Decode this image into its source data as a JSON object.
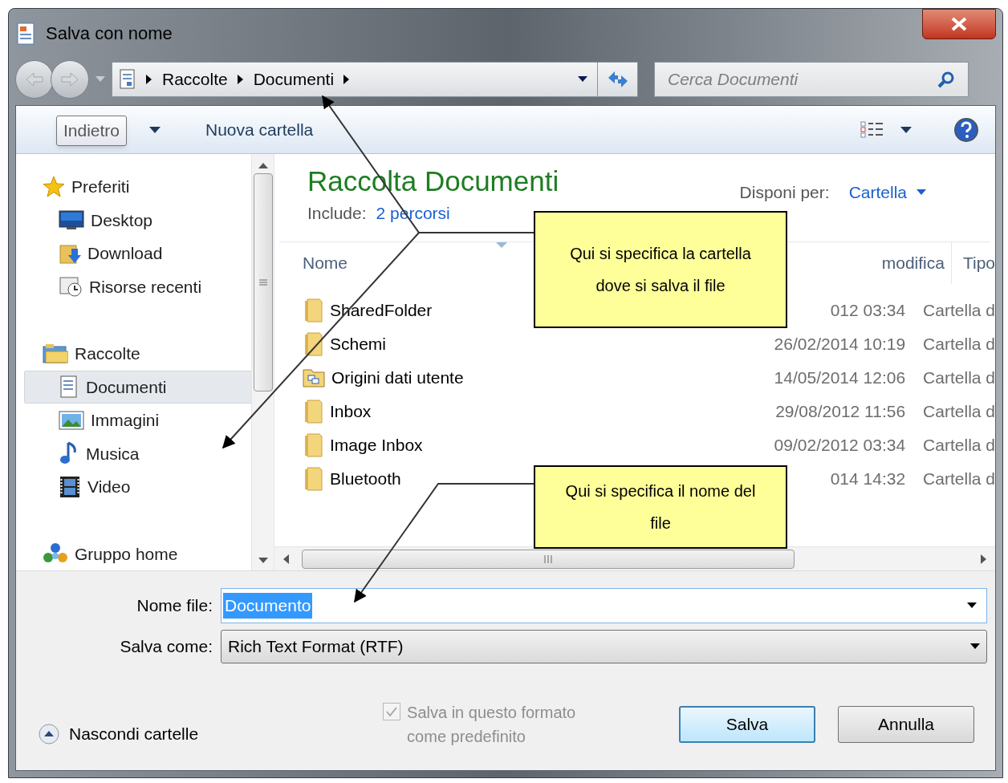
{
  "window": {
    "title": "Salva con nome"
  },
  "address": {
    "crumbs": [
      "Raccolte",
      "Documenti"
    ]
  },
  "search": {
    "placeholder": "Cerca Documenti"
  },
  "tooltip": "Indietro",
  "toolbar": {
    "new_folder": "Nuova cartella"
  },
  "sidebar": {
    "items": [
      {
        "label": "Preferiti",
        "kind": "star",
        "selected": false,
        "children": [
          {
            "label": "Desktop",
            "kind": "desktop",
            "selected": false
          },
          {
            "label": "Download",
            "kind": "download",
            "selected": false
          },
          {
            "label": "Risorse recenti",
            "kind": "recent",
            "selected": false
          }
        ]
      },
      {
        "label": "Raccolte",
        "kind": "library",
        "selected": false,
        "children": [
          {
            "label": "Documenti",
            "kind": "document",
            "selected": true
          },
          {
            "label": "Immagini",
            "kind": "images",
            "selected": false
          },
          {
            "label": "Musica",
            "kind": "music",
            "selected": false
          },
          {
            "label": "Video",
            "kind": "video",
            "selected": false
          }
        ]
      },
      {
        "label": "Gruppo home",
        "kind": "homegroup",
        "selected": false
      }
    ]
  },
  "library": {
    "title": "Raccolta Documenti",
    "include_label": "Include:",
    "include_link": "2 percorsi",
    "arrange_label": "Disponi per:",
    "arrange_value": "Cartella"
  },
  "table": {
    "columns": [
      "Nome",
      "modifica",
      "Tipo"
    ],
    "rows": [
      {
        "name": "SharedFolder",
        "kind": "folder",
        "date": "012 03:34",
        "type": "Cartella d"
      },
      {
        "name": "Schemi",
        "kind": "folder",
        "date": "26/02/2014 10:19",
        "type": "Cartella d"
      },
      {
        "name": "Origini dati utente",
        "kind": "datasource",
        "date": "14/05/2014 12:06",
        "type": "Cartella d"
      },
      {
        "name": "Inbox",
        "kind": "folder",
        "date": "29/08/2012 11:56",
        "type": "Cartella d"
      },
      {
        "name": "Image Inbox",
        "kind": "folder",
        "date": "09/02/2012 03:34",
        "type": "Cartella d"
      },
      {
        "name": "Bluetooth",
        "kind": "folder",
        "date": "014 14:32",
        "type": "Cartella d"
      }
    ]
  },
  "form": {
    "filename_label": "Nome file:",
    "filename": "Documento",
    "format_label": "Salva come:",
    "format": "Rich Text Format (RTF)"
  },
  "checkbox": {
    "label": "Salva in questo formato come predefinito",
    "checked": true,
    "disabled": true
  },
  "buttons": [
    {
      "label": "Salva",
      "default": true
    },
    {
      "label": "Annulla",
      "default": false
    }
  ],
  "hide_folders": "Nascondi cartelle",
  "callouts": [
    {
      "text": "Qui si specifica la cartella dove si salva il file"
    },
    {
      "text": "Qui si specifica il nome del file"
    }
  ]
}
